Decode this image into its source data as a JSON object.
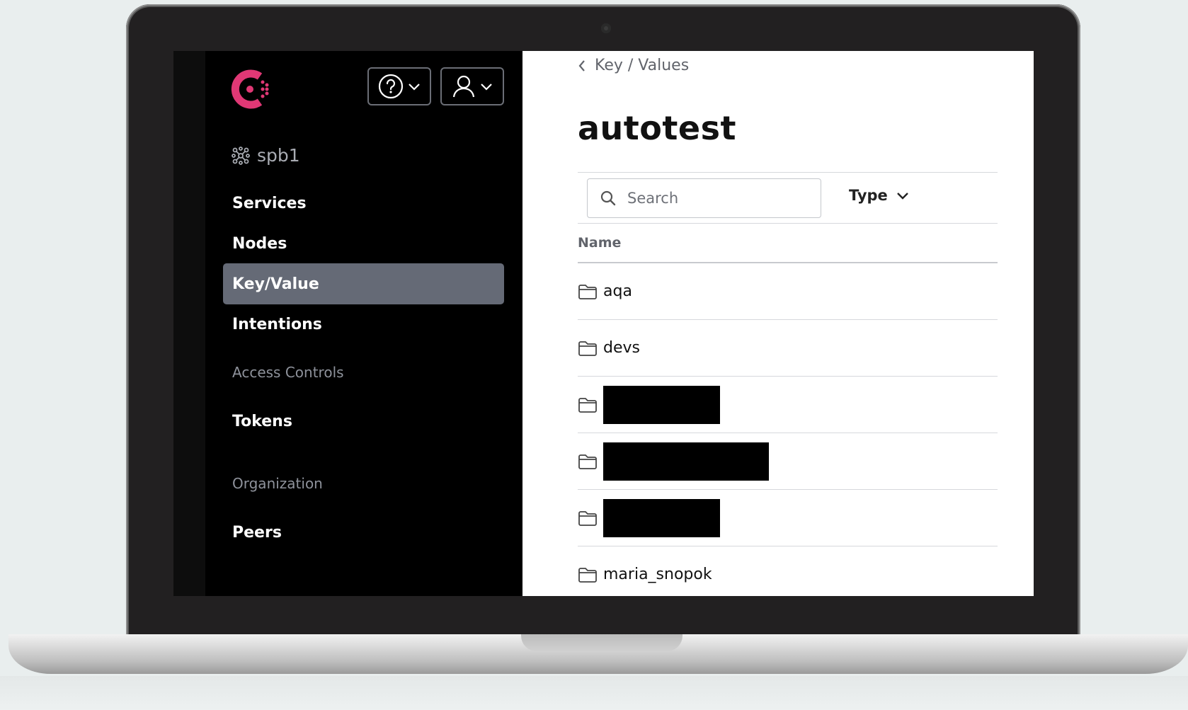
{
  "header": {
    "help_icon": "help-icon",
    "user_icon": "user-icon"
  },
  "datacenter": {
    "icon": "datacenter-icon",
    "name": "spb1"
  },
  "nav": {
    "services": "Services",
    "nodes": "Nodes",
    "key_value": "Key/Value",
    "intentions": "Intentions",
    "access_controls_heading": "Access Controls",
    "tokens": "Tokens",
    "organization_heading": "Organization",
    "peers": "Peers",
    "active_item": "Key/Value"
  },
  "breadcrumb": {
    "label": "Key / Values"
  },
  "page": {
    "title": "autotest"
  },
  "filters": {
    "search_placeholder": "Search",
    "search_value": "",
    "type_label": "Type"
  },
  "table": {
    "name_header": "Name",
    "rows": [
      {
        "name": "aqa",
        "icon": "folder-icon",
        "redacted": false
      },
      {
        "name": "devs",
        "icon": "folder-icon",
        "redacted": false
      },
      {
        "name": "",
        "icon": "folder-icon",
        "redacted": true
      },
      {
        "name": "",
        "icon": "folder-icon",
        "redacted": true
      },
      {
        "name": "",
        "icon": "folder-icon",
        "redacted": true
      },
      {
        "name": "maria_snopok",
        "icon": "folder-icon",
        "redacted": false
      }
    ]
  },
  "colors": {
    "brand": "#e03875",
    "sidebar_bg": "#000000",
    "active_nav": "#656a76"
  }
}
